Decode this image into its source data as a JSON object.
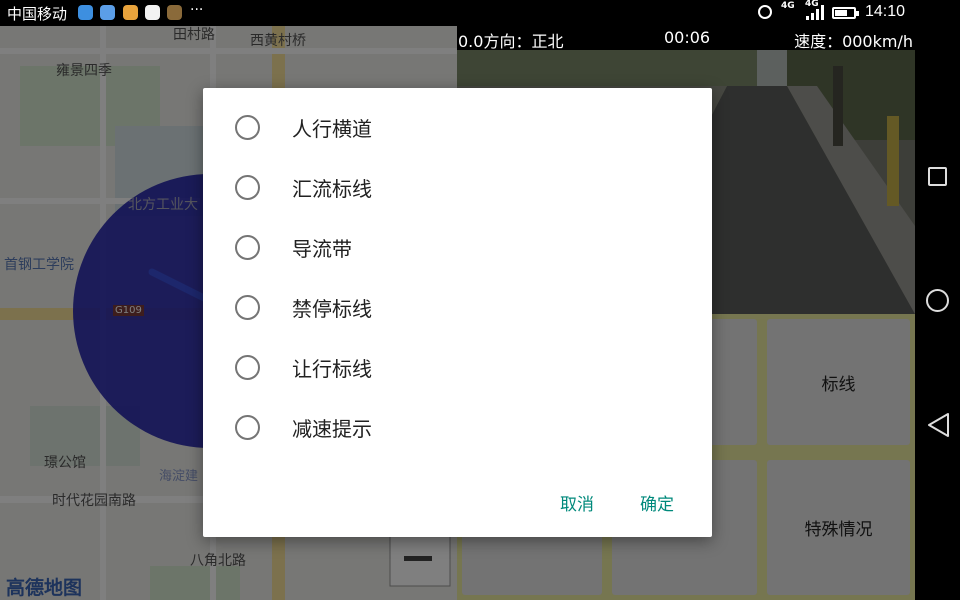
{
  "status_bar": {
    "carrier": "中国移动",
    "overflow": "···",
    "net_top": "4G",
    "net_bottom": "4G",
    "clock": "14:10",
    "battery_level": 0.65,
    "icons": [
      "app-notification-icon-blue",
      "app-notification-icon-map",
      "weibo-icon",
      "qq-icon",
      "camera-app-icon",
      "alarm-icon",
      "signal-icon",
      "battery-icon"
    ]
  },
  "map": {
    "labels": [
      "田村路",
      "西黄村桥",
      "雍景四季",
      "北方工业大",
      "首钢工学院",
      "G109",
      "璟公馆",
      "海淀建",
      "时代花园南路",
      "八角北路",
      "高德地图"
    ],
    "circle_color": "#1f1faa",
    "logo_color": "#3a66b8"
  },
  "camera": {
    "heading": "0.0方向：正北",
    "time": "00:06",
    "speed": "速度：000km/h"
  },
  "grid": {
    "buttons": [
      "标线",
      "特殊情况"
    ],
    "background": "#ededa0"
  },
  "dialog": {
    "options": [
      "人行横道",
      "汇流标线",
      "导流带",
      "禁停标线",
      "让行标线",
      "减速提示"
    ],
    "selected": null,
    "cancel_label": "取消",
    "ok_label": "确定",
    "accent": "#00897b"
  },
  "nav": {
    "icons": [
      "recent-apps-icon",
      "home-icon",
      "back-icon"
    ]
  }
}
